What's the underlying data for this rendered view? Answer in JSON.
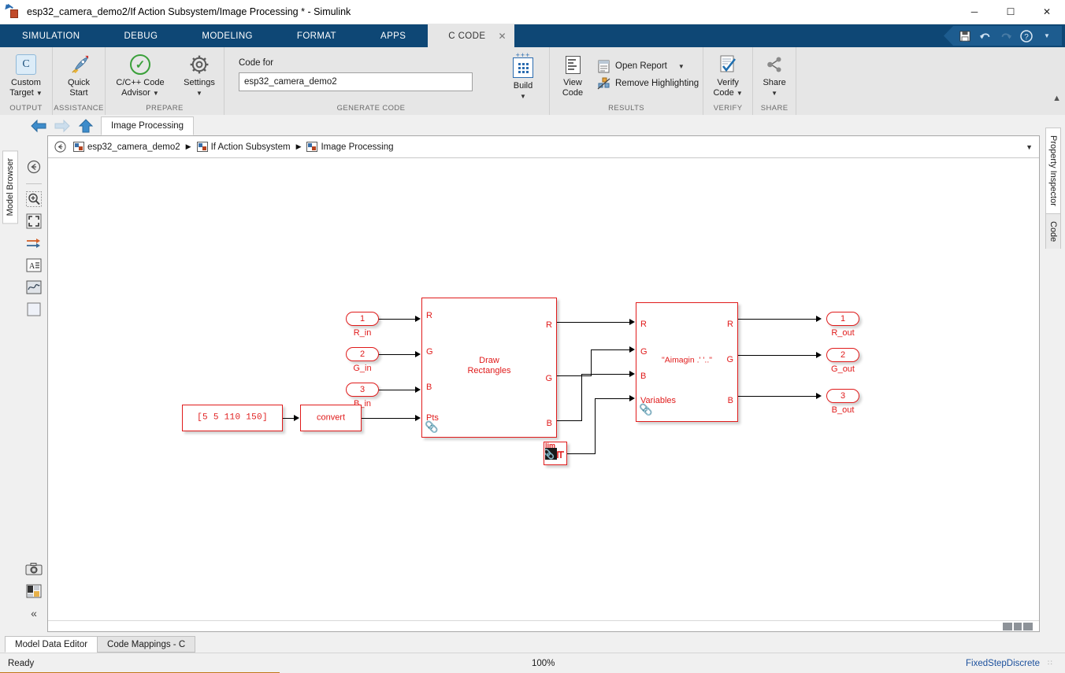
{
  "window": {
    "title": "esp32_camera_demo2/If Action Subsystem/Image Processing * - Simulink",
    "minimize": "─",
    "maximize": "☐",
    "close": "✕"
  },
  "tabs": [
    {
      "label": "SIMULATION",
      "active": false
    },
    {
      "label": "DEBUG",
      "active": false
    },
    {
      "label": "MODELING",
      "active": false
    },
    {
      "label": "FORMAT",
      "active": false
    },
    {
      "label": "APPS",
      "active": false
    },
    {
      "label": "C CODE",
      "active": true,
      "close": "✕"
    }
  ],
  "quick_access": {
    "save": "save-icon",
    "undo": "undo-icon",
    "redo": "redo-icon",
    "help": "help-icon",
    "more": "▼"
  },
  "ribbon": {
    "groups": [
      {
        "name": "OUTPUT",
        "buttons": [
          {
            "label": "Custom\nTarget",
            "icon": "c-target-icon",
            "caret": "▼"
          }
        ]
      },
      {
        "name": "ASSISTANCE",
        "buttons": [
          {
            "label": "Quick\nStart",
            "icon": "rocket-icon",
            "caret": ""
          }
        ]
      },
      {
        "name": "PREPARE",
        "buttons": [
          {
            "label": "C/C++ Code\nAdvisor",
            "icon": "check-circle-icon",
            "caret": "▼"
          },
          {
            "label": "Settings",
            "icon": "gear-icon",
            "caret": "▼"
          }
        ]
      },
      {
        "name": "GENERATE CODE",
        "code_for_label": "Code for",
        "code_for_value": "esp32_camera_demo2",
        "buttons": [
          {
            "label": "Build",
            "icon": "build-icon",
            "caret": "▼"
          }
        ]
      },
      {
        "name": "RESULTS",
        "buttons": [
          {
            "label": "View\nCode",
            "icon": "view-code-icon",
            "caret": ""
          }
        ],
        "small_buttons": [
          {
            "label": "Open Report",
            "icon": "report-icon",
            "caret": "▼"
          },
          {
            "label": "Remove Highlighting",
            "icon": "remove-highlight-icon",
            "caret": ""
          }
        ]
      },
      {
        "name": "VERIFY",
        "buttons": [
          {
            "label": "Verify\nCode",
            "icon": "verify-icon",
            "caret": "▼"
          }
        ]
      },
      {
        "name": "SHARE",
        "buttons": [
          {
            "label": "Share",
            "icon": "share-icon",
            "caret": "▼"
          }
        ]
      }
    ],
    "collapse": "▲"
  },
  "nav": {
    "back": "←",
    "forward": "→",
    "up": "↑",
    "tab_label": "Image Processing"
  },
  "breadcrumb": {
    "home_icon": "back-circle-icon",
    "items": [
      "esp32_camera_demo2",
      "If Action Subsystem",
      "Image Processing"
    ],
    "separator": "▶",
    "caret": "▼"
  },
  "left_dock": {
    "label": "Model Browser"
  },
  "right_dock": {
    "tabs": [
      "Property Inspector",
      "Code"
    ]
  },
  "canvas_tools": [
    {
      "name": "navigate-back-icon",
      "glyph": "←"
    },
    {
      "name": "zoom-in-icon",
      "glyph": "⊕"
    },
    {
      "name": "fit-to-view-icon",
      "glyph": "⛶"
    },
    {
      "name": "signal-lines-icon",
      "glyph": "↦"
    },
    {
      "name": "annotation-text-icon",
      "glyph": "A"
    },
    {
      "name": "scope-icon",
      "glyph": "∿"
    },
    {
      "name": "area-icon",
      "glyph": "□"
    },
    {
      "name": "screenshot-icon",
      "glyph": "◎"
    },
    {
      "name": "layout-icon",
      "glyph": "▤"
    },
    {
      "name": "collapse-toolbar-icon",
      "glyph": "«"
    }
  ],
  "diagram": {
    "inports": [
      {
        "number": "1",
        "label": "R_in"
      },
      {
        "number": "2",
        "label": "G_in"
      },
      {
        "number": "3",
        "label": "B_in"
      }
    ],
    "outports": [
      {
        "number": "1",
        "label": "R_out"
      },
      {
        "number": "2",
        "label": "G_out"
      },
      {
        "number": "3",
        "label": "B_out"
      }
    ],
    "constant_block": {
      "value": "[5    5 110 150]"
    },
    "convert_block": {
      "label": "convert"
    },
    "draw_rectangles_block": {
      "title": "Draw\nRectangles",
      "inputs": [
        "R",
        "G",
        "B",
        "Pts"
      ],
      "outputs": [
        "R",
        "G",
        "B"
      ],
      "link_icon": "library-link-icon"
    },
    "aimagin_block": {
      "title": "\"Aimagin .' '..\"",
      "inputs": [
        "R",
        "G",
        "B",
        "Variables"
      ],
      "outputs": [
        "R",
        "G",
        "B"
      ],
      "link_icon": "library-link-icon"
    },
    "lim_block": {
      "label": "lim",
      "link_icon": "library-link-icon"
    }
  },
  "bottom_tabs": [
    {
      "label": "Model Data Editor",
      "active": true
    },
    {
      "label": "Code Mappings - C",
      "active": false
    }
  ],
  "status": {
    "left": "Ready",
    "zoom": "100%",
    "right": "FixedStepDiscrete",
    "grip": "∷"
  },
  "colors": {
    "ribbon_bg": "#e6e6e6",
    "tabstrip_bg": "#0e4775",
    "block_red": "#e01b1b",
    "accent_link": "#1a4f9c",
    "progress_accent": "#c07818"
  }
}
